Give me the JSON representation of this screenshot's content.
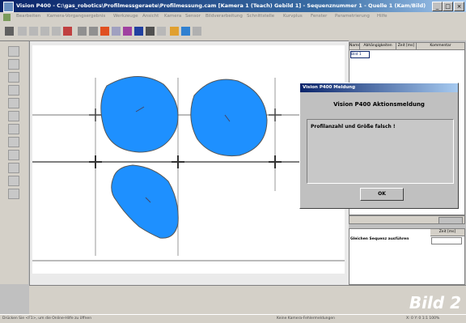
{
  "window": {
    "title": "Vision P400 - C:\\gas_robotics\\Profilmessgeraete\\Profilmessung.cam [Kamera 1 (Teach) Gebild 1] - Sequenznummer 1 - Quelle 1 (Kam/Bild)",
    "minimize": "_",
    "maximize": "□",
    "close": "×"
  },
  "menu": [
    "Bearbeiten",
    "Kamera-Vorgangsergebnis",
    "Werkzeuge",
    "Ansicht",
    "Kamera",
    "Sensor",
    "Bildverarbeitung",
    "Schnittstelle",
    "Kurvplus",
    "Fenster",
    "Parametrierung",
    "Hilfe"
  ],
  "right_table": {
    "headers": [
      "Name",
      "Abhängigkeiten",
      "Zeit [ms]",
      "Kommentar"
    ],
    "first_row_name": "Bild 1"
  },
  "status_table": {
    "headers": [
      "Zeit [ms]"
    ],
    "row_label": "Gleichen Sequenz ausführen",
    "row_value": ""
  },
  "dialog": {
    "title": "Vision P400 Meldung",
    "heading": "Vision P400 Aktionsmeldung",
    "message": "Profilanzahl und Größe falsch !",
    "ok": "OK"
  },
  "overlay_text": "Bild 2",
  "statusbar": {
    "left": "Drücken Sie <F1>, um die Online-Hilfe zu öffnen",
    "middle": "Keine Kamera-Fehlermeldungen",
    "right": "X: 0  Y: 0   1:1  100%"
  },
  "colors": {
    "blob": "#1e90ff",
    "titlebar": "#0a246a",
    "overlay": "#ffffff"
  }
}
